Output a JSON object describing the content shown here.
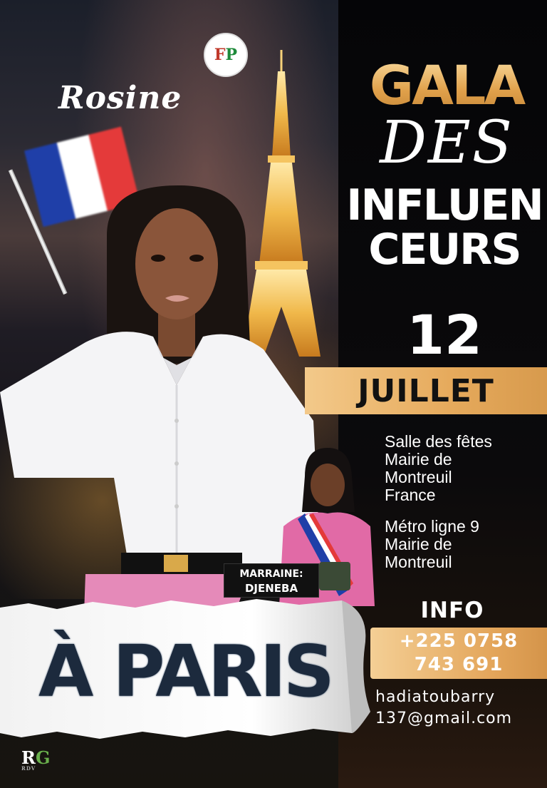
{
  "event": {
    "name_prefix": "Rosine",
    "title_line1": "GALA",
    "title_line2": "DES",
    "title_line3": "INFLUEN",
    "title_line4": "CEURS",
    "day": "12",
    "month": "JUILLET",
    "city": "À PARIS"
  },
  "venue": {
    "line1": "Salle des fêtes",
    "line2": "Mairie de",
    "line3": "Montreuil",
    "line4": "France"
  },
  "metro": {
    "line1": "Métro ligne  9",
    "line2": "Mairie de",
    "line3": "Montreuil"
  },
  "marraine": {
    "label": "MARRAINE:",
    "name": "DJENEBA"
  },
  "info": {
    "title": "INFO",
    "phone_line1": "+225 0758",
    "phone_line2": "743 691",
    "email_line1": "hadiatoubarry",
    "email_line2": "137@gmail.com"
  },
  "logo": {
    "text": "FP",
    "text_accent": "P",
    "bottom_logo": "R",
    "bottom_logo_accent": "G",
    "bottom_logo_small": "RDV"
  },
  "colors": {
    "gold": "#e6aa5c",
    "dark": "#0b0a0c",
    "flag_blue": "#1f3fa8",
    "flag_white": "#ffffff",
    "flag_red": "#e43a3a"
  }
}
